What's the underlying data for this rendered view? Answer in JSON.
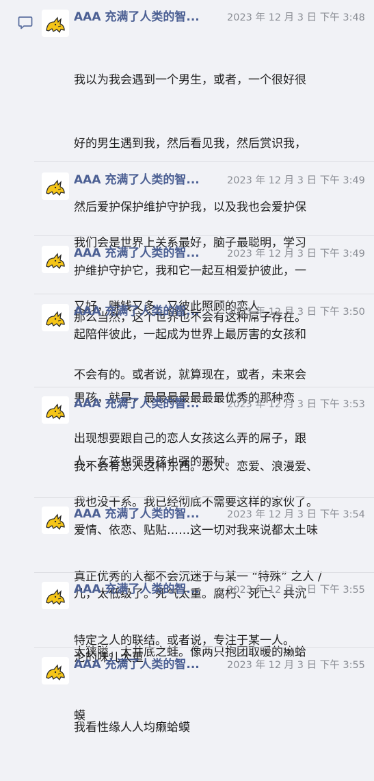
{
  "thread": {
    "comment_icon": "comment-icon",
    "avatar_icon": "yellow-cat-avatar",
    "messages": [
      {
        "author": "AAA 充满了人类的智...",
        "time": "2023 年 12 月 3 日  下午 3:48",
        "lines": [
          "我以为我会遇到一个男生，或者，一个很好很",
          "好的男生遇到我，然后看见我，然后赏识我，",
          "然后爱护保护维护守护我，以及我也会爱护保",
          "护维护守护它，我和它一起互相爱护彼此，一",
          "起陪伴彼此，一起成为世界上最厉害的女孩和",
          "男孩，就是，最最最最最最最优秀的那种恋",
          "人，女孩也强男孩也强的那种。"
        ]
      },
      {
        "author": "AAA 充满了人类的智...",
        "time": "2023 年 12 月 3 日  下午 3:49",
        "lines": [
          "我们会是世界上关系最好，脑子最聪明，学习",
          "又好，赚钱又多，又彼此照顾的恋人"
        ]
      },
      {
        "author": "AAA 充满了人类的智...",
        "time": "2023 年 12 月 3 日  下午 3:49",
        "lines": [
          "那么当然，这个世界也不会有这种屌子存在。"
        ]
      },
      {
        "author": "AAA 充满了人类的智...",
        "time": "2023 年 12 月 3 日  下午 3:50",
        "lines": [
          "不会有的。或者说，就算现在，或者，未来会",
          "出现想要跟自己的恋人女孩这么弄的屌子，跟",
          "我也没干系。我已经彻底不需要这样的家伙了。"
        ]
      },
      {
        "author": "AAA 充满了人类的智...",
        "time": "2023 年 12 月 3 日  下午 3:53",
        "lines": [
          "我不会有恋人这种东西。恋人、恋爱、浪漫爱、",
          "爱情、依恋、贴贴……这一切对我来说都太土味",
          "儿，太低级了。死气太重。腐朽、死亡、共沉",
          "沦的味儿太重"
        ]
      },
      {
        "author": "AAA 充满了人类的智...",
        "time": "2023 年 12 月 3 日  下午 3:54",
        "lines": [
          "真正优秀的人都不会沉迷于与某一 “特殊” 之人 /",
          "特定之人的联结。或者说，专注于某一人。"
        ]
      },
      {
        "author": "AAA 充满了人类的智...",
        "time": "2023 年 12 月 3 日  下午 3:55",
        "lines": [
          "太狭隘。太井底之蛙。像两只抱团取暖的癞蛤",
          "蟆"
        ]
      },
      {
        "author": "AAA 充满了人类的智...",
        "time": "2023 年 12 月 3 日  下午 3:55",
        "lines": [
          "我看性缘人人均癞蛤蟆"
        ]
      }
    ]
  }
}
